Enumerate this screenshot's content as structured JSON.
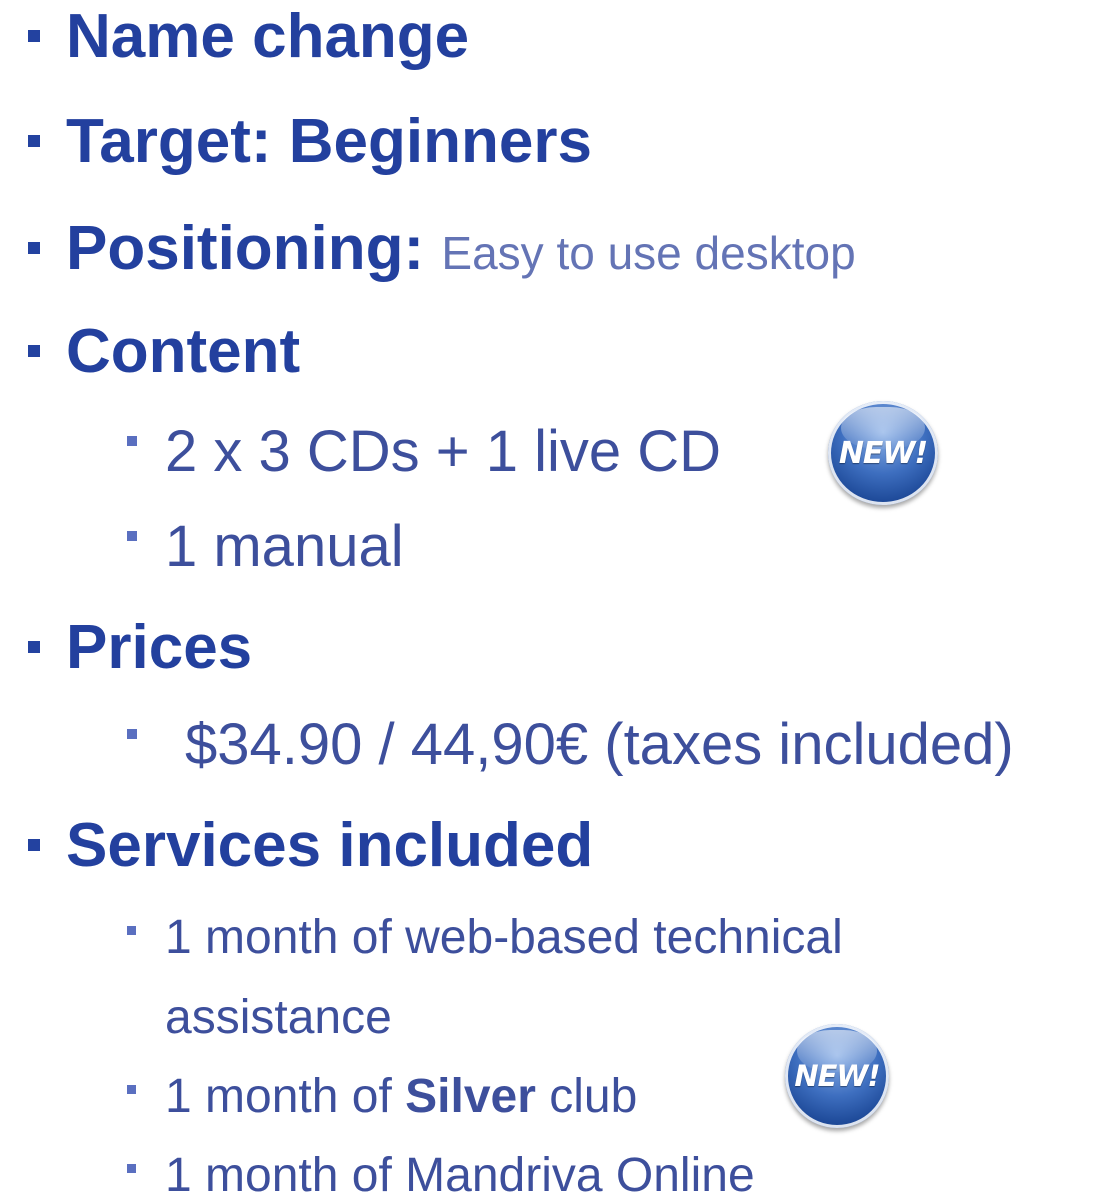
{
  "items": {
    "name_change": "Name change",
    "target": "Target: Beginners",
    "positioning_label": "Positioning:",
    "positioning_desc": "Easy to use desktop",
    "content": "Content",
    "content_sub1": "2 x 3 CDs + 1 live CD",
    "content_sub2": "1 manual",
    "prices": "Prices",
    "prices_sub1": "$34.90 / 44,90€ (taxes included)",
    "services": "Services included",
    "services_sub1_line1": "1 month of web-based technical",
    "services_sub1_line2": "assistance",
    "services_sub2_pre": "1 month of ",
    "services_sub2_bold": "Silver",
    "services_sub2_post": " club",
    "services_sub3": "1 month of Mandriva Online"
  },
  "badges": {
    "new_label": "NEW!"
  },
  "colors": {
    "heading": "#23409e",
    "subitem": "#3d4f9c",
    "badge": "#2f5fb0"
  }
}
